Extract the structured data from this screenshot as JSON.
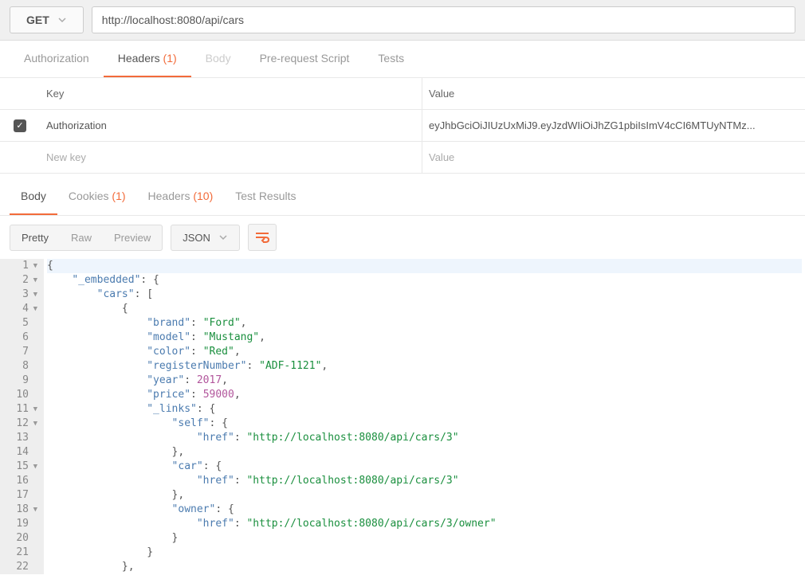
{
  "request": {
    "method": "GET",
    "url": "http://localhost:8080/api/cars"
  },
  "requestTabs": {
    "authorization": "Authorization",
    "headers": "Headers",
    "headersCount": "(1)",
    "body": "Body",
    "prerequest": "Pre-request Script",
    "tests": "Tests"
  },
  "headersTable": {
    "keyHeader": "Key",
    "valueHeader": "Value",
    "row": {
      "key": "Authorization",
      "value": "eyJhbGciOiJIUzUxMiJ9.eyJzdWIiOiJhZG1pbiIsImV4cCI6MTUyNTMz..."
    },
    "newKey": "New key",
    "newValue": "Value"
  },
  "responseTabs": {
    "body": "Body",
    "cookies": "Cookies",
    "cookiesCount": "(1)",
    "headers": "Headers",
    "headersCount": "(10)",
    "testResults": "Test Results"
  },
  "toolbar": {
    "pretty": "Pretty",
    "raw": "Raw",
    "preview": "Preview",
    "format": "JSON"
  },
  "code": {
    "lines": [
      {
        "n": 1,
        "fold": true,
        "tokens": [
          {
            "t": "pun",
            "v": "{"
          }
        ]
      },
      {
        "n": 2,
        "fold": true,
        "indent": 4,
        "tokens": [
          {
            "t": "key",
            "v": "\"_embedded\""
          },
          {
            "t": "pun",
            "v": ": {"
          }
        ]
      },
      {
        "n": 3,
        "fold": true,
        "indent": 8,
        "tokens": [
          {
            "t": "key",
            "v": "\"cars\""
          },
          {
            "t": "pun",
            "v": ": ["
          }
        ]
      },
      {
        "n": 4,
        "fold": true,
        "indent": 12,
        "tokens": [
          {
            "t": "pun",
            "v": "{"
          }
        ]
      },
      {
        "n": 5,
        "indent": 16,
        "tokens": [
          {
            "t": "key",
            "v": "\"brand\""
          },
          {
            "t": "pun",
            "v": ": "
          },
          {
            "t": "str",
            "v": "\"Ford\""
          },
          {
            "t": "pun",
            "v": ","
          }
        ]
      },
      {
        "n": 6,
        "indent": 16,
        "tokens": [
          {
            "t": "key",
            "v": "\"model\""
          },
          {
            "t": "pun",
            "v": ": "
          },
          {
            "t": "str",
            "v": "\"Mustang\""
          },
          {
            "t": "pun",
            "v": ","
          }
        ]
      },
      {
        "n": 7,
        "indent": 16,
        "tokens": [
          {
            "t": "key",
            "v": "\"color\""
          },
          {
            "t": "pun",
            "v": ": "
          },
          {
            "t": "str",
            "v": "\"Red\""
          },
          {
            "t": "pun",
            "v": ","
          }
        ]
      },
      {
        "n": 8,
        "indent": 16,
        "tokens": [
          {
            "t": "key",
            "v": "\"registerNumber\""
          },
          {
            "t": "pun",
            "v": ": "
          },
          {
            "t": "str",
            "v": "\"ADF-1121\""
          },
          {
            "t": "pun",
            "v": ","
          }
        ]
      },
      {
        "n": 9,
        "indent": 16,
        "tokens": [
          {
            "t": "key",
            "v": "\"year\""
          },
          {
            "t": "pun",
            "v": ": "
          },
          {
            "t": "num",
            "v": "2017"
          },
          {
            "t": "pun",
            "v": ","
          }
        ]
      },
      {
        "n": 10,
        "indent": 16,
        "tokens": [
          {
            "t": "key",
            "v": "\"price\""
          },
          {
            "t": "pun",
            "v": ": "
          },
          {
            "t": "num",
            "v": "59000"
          },
          {
            "t": "pun",
            "v": ","
          }
        ]
      },
      {
        "n": 11,
        "fold": true,
        "indent": 16,
        "tokens": [
          {
            "t": "key",
            "v": "\"_links\""
          },
          {
            "t": "pun",
            "v": ": {"
          }
        ]
      },
      {
        "n": 12,
        "fold": true,
        "indent": 20,
        "tokens": [
          {
            "t": "key",
            "v": "\"self\""
          },
          {
            "t": "pun",
            "v": ": {"
          }
        ]
      },
      {
        "n": 13,
        "indent": 24,
        "tokens": [
          {
            "t": "key",
            "v": "\"href\""
          },
          {
            "t": "pun",
            "v": ": "
          },
          {
            "t": "str",
            "v": "\"http://localhost:8080/api/cars/3\""
          }
        ]
      },
      {
        "n": 14,
        "indent": 20,
        "tokens": [
          {
            "t": "pun",
            "v": "},"
          }
        ]
      },
      {
        "n": 15,
        "fold": true,
        "indent": 20,
        "tokens": [
          {
            "t": "key",
            "v": "\"car\""
          },
          {
            "t": "pun",
            "v": ": {"
          }
        ]
      },
      {
        "n": 16,
        "indent": 24,
        "tokens": [
          {
            "t": "key",
            "v": "\"href\""
          },
          {
            "t": "pun",
            "v": ": "
          },
          {
            "t": "str",
            "v": "\"http://localhost:8080/api/cars/3\""
          }
        ]
      },
      {
        "n": 17,
        "indent": 20,
        "tokens": [
          {
            "t": "pun",
            "v": "},"
          }
        ]
      },
      {
        "n": 18,
        "fold": true,
        "indent": 20,
        "tokens": [
          {
            "t": "key",
            "v": "\"owner\""
          },
          {
            "t": "pun",
            "v": ": {"
          }
        ]
      },
      {
        "n": 19,
        "indent": 24,
        "tokens": [
          {
            "t": "key",
            "v": "\"href\""
          },
          {
            "t": "pun",
            "v": ": "
          },
          {
            "t": "str",
            "v": "\"http://localhost:8080/api/cars/3/owner\""
          }
        ]
      },
      {
        "n": 20,
        "indent": 20,
        "tokens": [
          {
            "t": "pun",
            "v": "}"
          }
        ]
      },
      {
        "n": 21,
        "indent": 16,
        "tokens": [
          {
            "t": "pun",
            "v": "}"
          }
        ]
      },
      {
        "n": 22,
        "indent": 12,
        "tokens": [
          {
            "t": "pun",
            "v": "},"
          }
        ]
      }
    ]
  }
}
